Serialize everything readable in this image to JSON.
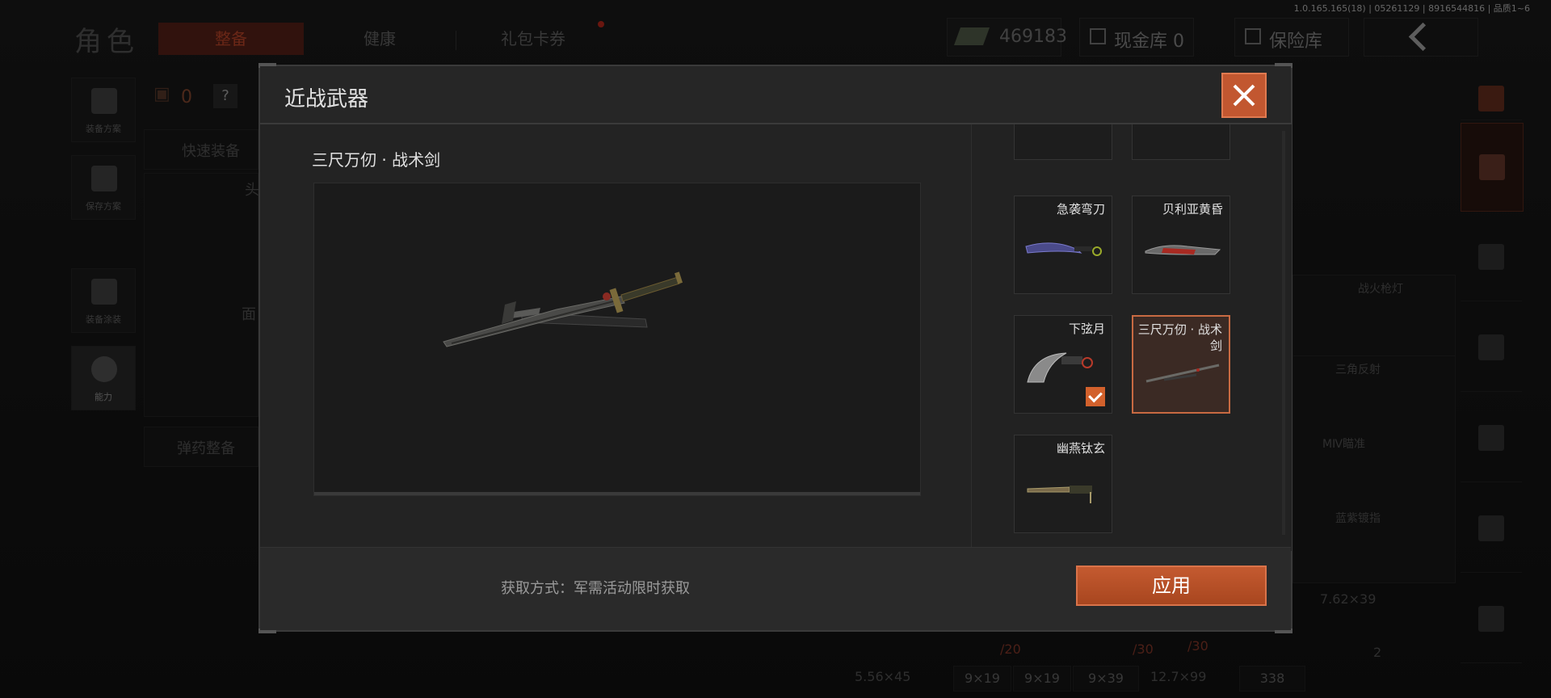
{
  "build_info": "1.0.165.165(18) | 05261129 | 8916544816 | 品质1~6",
  "header": {
    "page_title": "角色",
    "tabs": [
      {
        "label": "整备",
        "active": true
      },
      {
        "label": "健康",
        "active": false
      },
      {
        "label": "礼包卡券",
        "active": false
      }
    ],
    "money": "469183",
    "cash_vault": "现金库 0",
    "safe_box": "保险库"
  },
  "left_nav": [
    {
      "label": "装备方案",
      "icon": "vest-icon"
    },
    {
      "label": "保存方案",
      "icon": "download-icon"
    },
    {
      "label": "装备涂装",
      "icon": "helmet-icon"
    },
    {
      "label": "能力",
      "icon": "lightning-icon"
    }
  ],
  "background": {
    "backpack_count": "0",
    "help_mark": "?",
    "quick_equip": "快速装备",
    "head_label": "头",
    "face_label": "面",
    "ammo_equip": "弹药整备",
    "weapon_labels": [
      "战火枪灯",
      "三角反射",
      "MⅣ瞄准",
      "蓝紫镀指"
    ],
    "ammo_cells": [
      {
        "caliber": "5.56×45",
        "count": "/20"
      },
      {
        "caliber": "9×19",
        "count": "/30"
      },
      {
        "caliber": "9×19",
        "count": "/30"
      },
      {
        "caliber": "9×39",
        "count": ""
      },
      {
        "caliber": "12.7×99",
        "count": "/30"
      },
      {
        "caliber": "338",
        "count": ""
      },
      {
        "caliber": "7.62×39",
        "count": "2"
      }
    ]
  },
  "modal": {
    "title": "近战武器",
    "selected_item": "三尺万仞 · 战术剑",
    "items": [
      {
        "name": "急袭弯刀",
        "equipped": false,
        "selected": false,
        "icon": "karambit-blue-icon"
      },
      {
        "name": "贝利亚黄昏",
        "equipped": false,
        "selected": false,
        "icon": "dagger-red-icon"
      },
      {
        "name": "下弦月",
        "equipped": true,
        "selected": false,
        "icon": "crescent-knife-icon"
      },
      {
        "name": "三尺万仞 · 战术剑",
        "equipped": false,
        "selected": true,
        "icon": "tactical-sword-icon"
      },
      {
        "name": "幽燕钛玄",
        "equipped": false,
        "selected": false,
        "icon": "blade-gold-icon"
      }
    ],
    "acquire_text": "获取方式：军需活动限时获取",
    "apply_label": "应用"
  },
  "colors": {
    "accent": "#c25730",
    "accent_border": "#e07a50",
    "panel": "#232323"
  }
}
